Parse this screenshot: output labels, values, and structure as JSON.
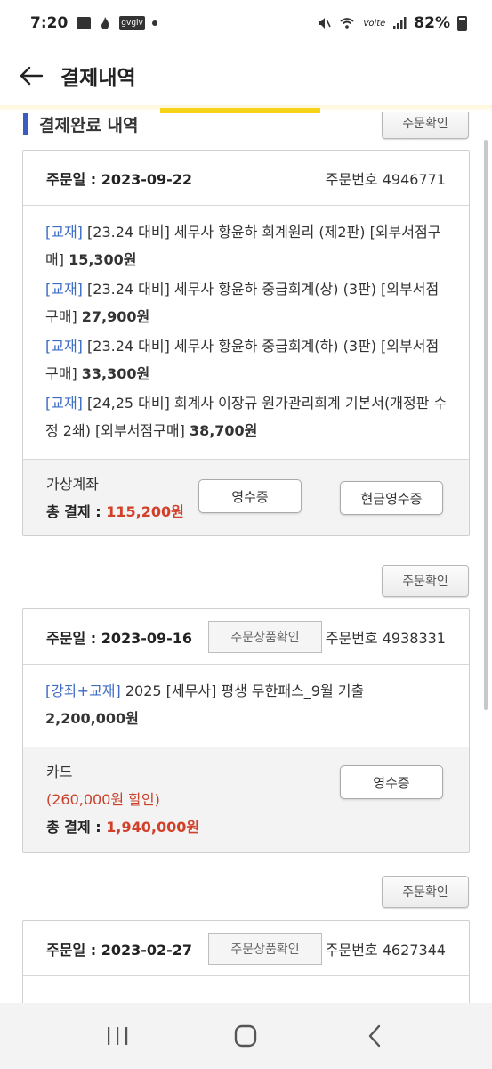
{
  "status_bar": {
    "time": "7:20",
    "badge": "gvgiv",
    "volte": "Volte",
    "battery": "82%"
  },
  "header": {
    "title": "결제내역",
    "accent_color": "#f5d317"
  },
  "section": {
    "title": "결제완료 내역",
    "marker_color": "#3a5bbf"
  },
  "confirm_label": "주문확인",
  "orders": [
    {
      "date_label": "주문일 : 2023-09-22",
      "order_no": "주문번호 4946771",
      "items": [
        {
          "tag": "[교재]",
          "text": " [23.24 대비] 세무사 황윤하 회계원리 (제2판) [외부서점구매] ",
          "price": "15,300원"
        },
        {
          "tag": "[교재]",
          "text": " [23.24 대비] 세무사 황윤하 중급회계(상) (3판) [외부서점구매] ",
          "price": "27,900원"
        },
        {
          "tag": "[교재]",
          "text": " [23.24 대비] 세무사 황윤하 중급회계(하) (3판) [외부서점구매] ",
          "price": "33,300원"
        },
        {
          "tag": "[교재]",
          "text": " [24,25 대비] 회계사 이장규 원가관리회계 기본서(개정판 수정 2쇄) [외부서점구매] ",
          "price": "38,700원"
        }
      ],
      "method": "가상계좌",
      "total_label": "총 결제 : ",
      "total_value": "115,200원",
      "receipt_label": "영수증",
      "cash_receipt_label": "현금영수증"
    },
    {
      "date_label": "주문일 : 2023-09-16",
      "item_check_label": "주문상품확인",
      "order_no": "주문번호 4938331",
      "items": [
        {
          "tag": "[강좌+교재]",
          "text": " 2025 [세무사] 평생 무한패스_9월 기출 ",
          "price": "2,200,000원"
        }
      ],
      "method": "카드",
      "discount": "(260,000원 할인)",
      "total_label": "총 결제 : ",
      "total_value": "1,940,000원",
      "receipt_label": "영수증"
    },
    {
      "date_label": "주문일 : 2023-02-27",
      "item_check_label": "주문상품확인",
      "order_no": "주문번호 4627344"
    }
  ]
}
